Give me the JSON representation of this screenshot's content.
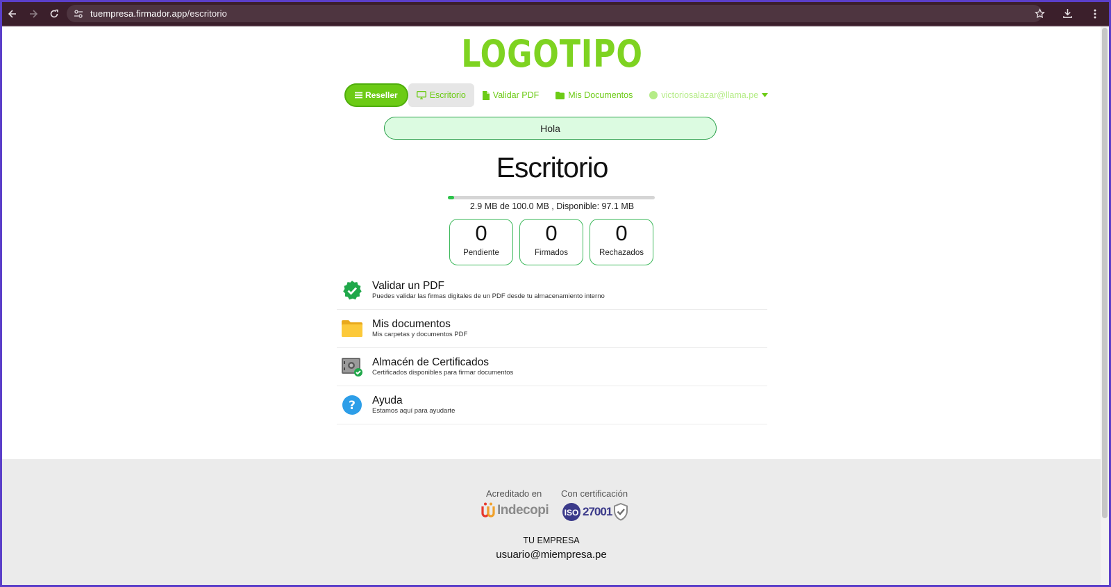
{
  "browser": {
    "url_host": "tuempresa.firmador.app",
    "url_path": "/escritorio"
  },
  "header": {
    "logo": "LOGOTIPO",
    "nav": {
      "reseller": "Reseller",
      "escritorio": "Escritorio",
      "validar": "Validar PDF",
      "documentos": "Mis Documentos",
      "user": "victoriosalazar@llama.pe"
    },
    "greeting": "Hola"
  },
  "main": {
    "title": "Escritorio",
    "storage": {
      "text": "2.9 MB de 100.0 MB , Disponible: 97.1 MB",
      "used_fraction": 0.029
    },
    "stats": [
      {
        "value": "0",
        "label": "Pendiente"
      },
      {
        "value": "0",
        "label": "Firmados"
      },
      {
        "value": "0",
        "label": "Rechazados"
      }
    ],
    "menu": [
      {
        "title": "Validar un PDF",
        "subtitle": "Puedes validar las firmas digitales de un PDF desde tu almacenamiento interno",
        "icon": "verified-check-icon"
      },
      {
        "title": "Mis documentos",
        "subtitle": "Mis carpetas y documentos PDF",
        "icon": "folder-icon"
      },
      {
        "title": "Almacén de Certificados",
        "subtitle": "Certificados disponibles para firmar documentos",
        "icon": "safe-icon"
      },
      {
        "title": "Ayuda",
        "subtitle": "Estamos aquí para ayudarte",
        "icon": "help-icon"
      }
    ]
  },
  "footer": {
    "acreditado": "Acreditado en",
    "indecopi": "Indecopi",
    "certificacion": "Con certificación",
    "iso_badge": "ISO",
    "iso_number": "27001",
    "company": "TU EMPRESA",
    "email": "usuario@miempresa.pe"
  },
  "colors": {
    "brand_green": "#7ed321",
    "accent_green": "#2cc34a",
    "browser_frame": "#5b3fc9"
  }
}
